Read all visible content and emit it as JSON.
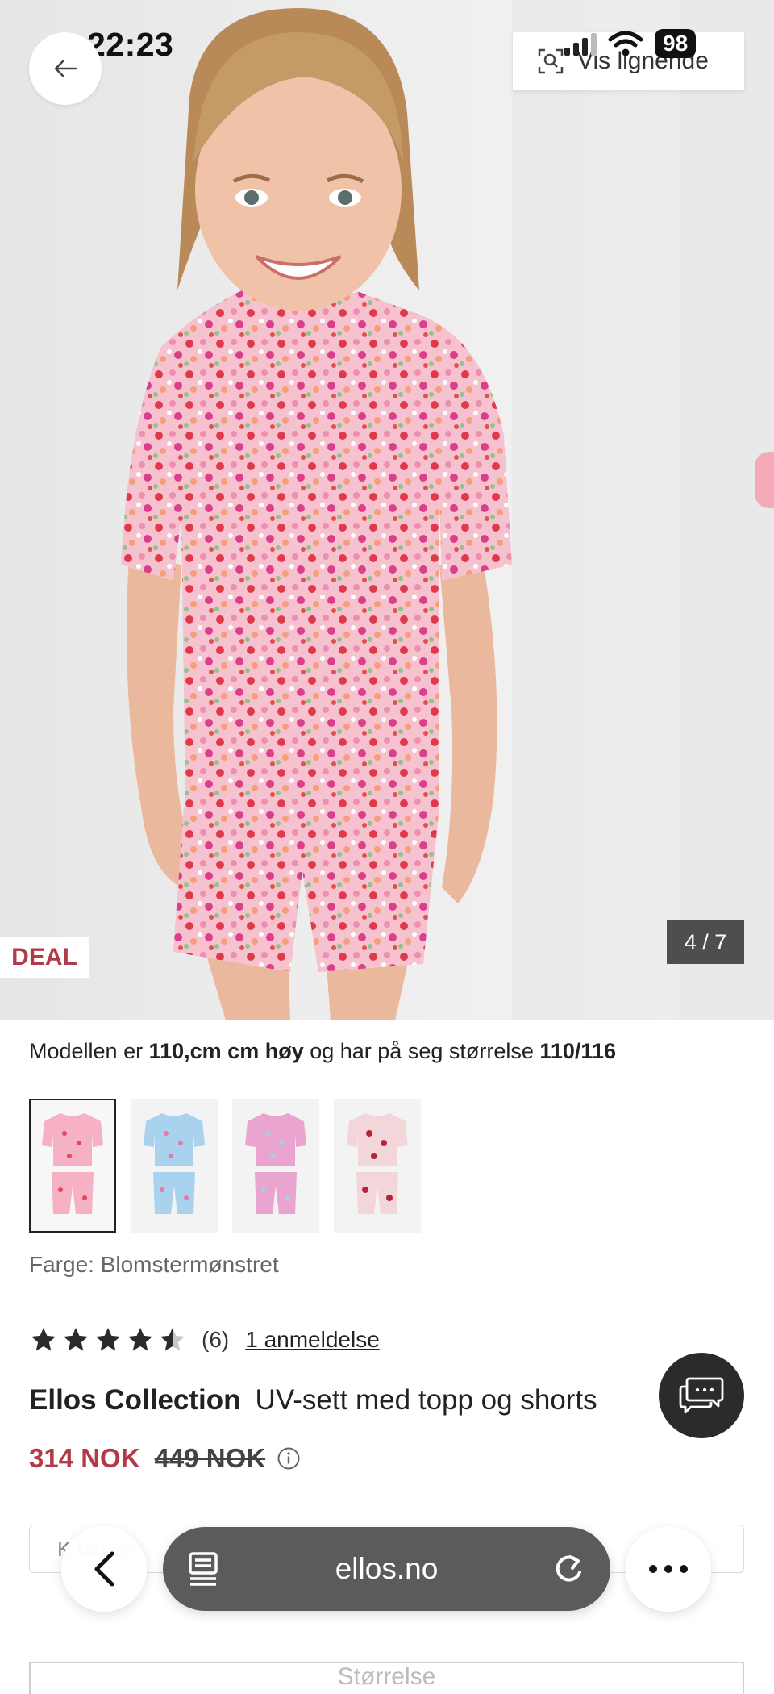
{
  "status_bar": {
    "time": "22:23",
    "battery": "98"
  },
  "gallery": {
    "similar_button": "Vis lignende",
    "deal_badge": "DEAL",
    "counter": "4 / 7"
  },
  "model_info": {
    "prefix": "Modellen er ",
    "height": "110,cm cm høy",
    "middle": " og har på seg størrelse ",
    "size": "110/116"
  },
  "color_options": [
    {
      "name": "pink-floral",
      "shirt": "#f6b1c4",
      "dots": "#e04a5a"
    },
    {
      "name": "blue-floral",
      "shirt": "#a9d2ef",
      "dots": "#e27aa3"
    },
    {
      "name": "lilac-floral",
      "shirt": "#e9a4d0",
      "dots": "#9fd0e6"
    },
    {
      "name": "red-floral",
      "shirt": "#f2d6d9",
      "dots": "#b3263a"
    }
  ],
  "color_label": "Farge: Blomstermønstret",
  "rating": {
    "stars": 4.5,
    "count": "(6)",
    "reviews_link": "1 anmeldelse"
  },
  "product": {
    "brand": "Ellos Collection",
    "name": "UV-sett med topp og shorts",
    "price": "314 NOK",
    "old_price": "449 NOK"
  },
  "hidden_box_text": "K      bet                                                                    ell",
  "size_selector": "Størrelse",
  "browser": {
    "url": "ellos.no"
  },
  "colors": {
    "accent": "#b23a48",
    "dark": "#2b2b2b",
    "url_bar": "#5b5b5b"
  }
}
